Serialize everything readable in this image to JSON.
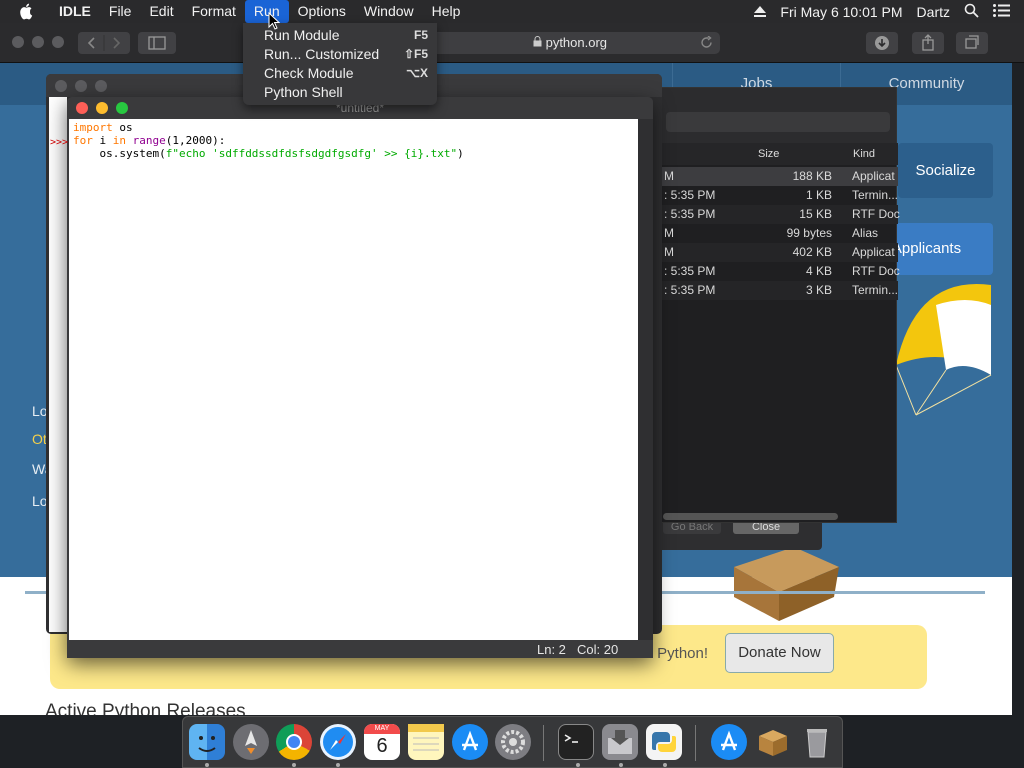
{
  "menubar": {
    "app": "IDLE",
    "items": [
      "File",
      "Edit",
      "Format",
      "Run",
      "Options",
      "Window",
      "Help"
    ],
    "active": "Run",
    "clock": "Fri May 6  10:01 PM",
    "user": "Dartz"
  },
  "run_menu": {
    "items": [
      {
        "label": "Run Module",
        "shortcut": "F5"
      },
      {
        "label": "Run... Customized",
        "shortcut": "⇧F5"
      },
      {
        "label": "Check Module",
        "shortcut": "⌥X"
      },
      {
        "label": "Python Shell",
        "shortcut": ""
      }
    ]
  },
  "safari": {
    "address": "python.org"
  },
  "page": {
    "nav": [
      "Jobs",
      "Community"
    ],
    "socialize": "Socialize",
    "applicants": "Applicants",
    "left_links": [
      "Lo",
      "Ot",
      "Wa",
      "Lo"
    ],
    "donate_text": "r Python!",
    "donate_button": "Donate Now",
    "active_releases": "Active Python Releases"
  },
  "finder": {
    "columns": [
      "Size",
      "Kind"
    ],
    "rows": [
      {
        "date": "M",
        "size": "188 KB",
        "kind": "Applicat"
      },
      {
        "date": ": 5:35 PM",
        "size": "1 KB",
        "kind": "Termin..."
      },
      {
        "date": ": 5:35 PM",
        "size": "15 KB",
        "kind": "RTF Doc"
      },
      {
        "date": "M",
        "size": "99 bytes",
        "kind": "Alias"
      },
      {
        "date": "M",
        "size": "402 KB",
        "kind": "Applicat"
      },
      {
        "date": ": 5:35 PM",
        "size": "4 KB",
        "kind": "RTF Doc"
      },
      {
        "date": ": 5:35 PM",
        "size": "3 KB",
        "kind": "Termin..."
      }
    ],
    "back_button": "Go Back",
    "close_button": "Close"
  },
  "editor": {
    "title": "*untitled*",
    "code_lines": [
      {
        "a": "import",
        "b": " os"
      },
      {
        "a": "for",
        "b": " i ",
        "c": "in",
        "d": " ",
        "e": "range",
        "f": "(1,2000):"
      },
      {
        "a": "    os.system(",
        "b": "f\"echo 'sdffddssdfdsfsdgdfgsdfg' >> {i}.txt\"",
        "c": ")"
      }
    ],
    "status": {
      "line": "Ln: 2",
      "col": "Col: 20"
    }
  },
  "shell": {
    "prompt": ">>>"
  },
  "dock": {
    "apps": [
      "finder",
      "launchpad",
      "chrome",
      "safari",
      "calendar",
      "notes",
      "app-store",
      "system-preferences",
      "terminal",
      "disk-utility",
      "python-launcher",
      "app-store-2",
      "archive-utility",
      "trash"
    ],
    "calendar": {
      "month": "MAY",
      "day": "6"
    }
  }
}
